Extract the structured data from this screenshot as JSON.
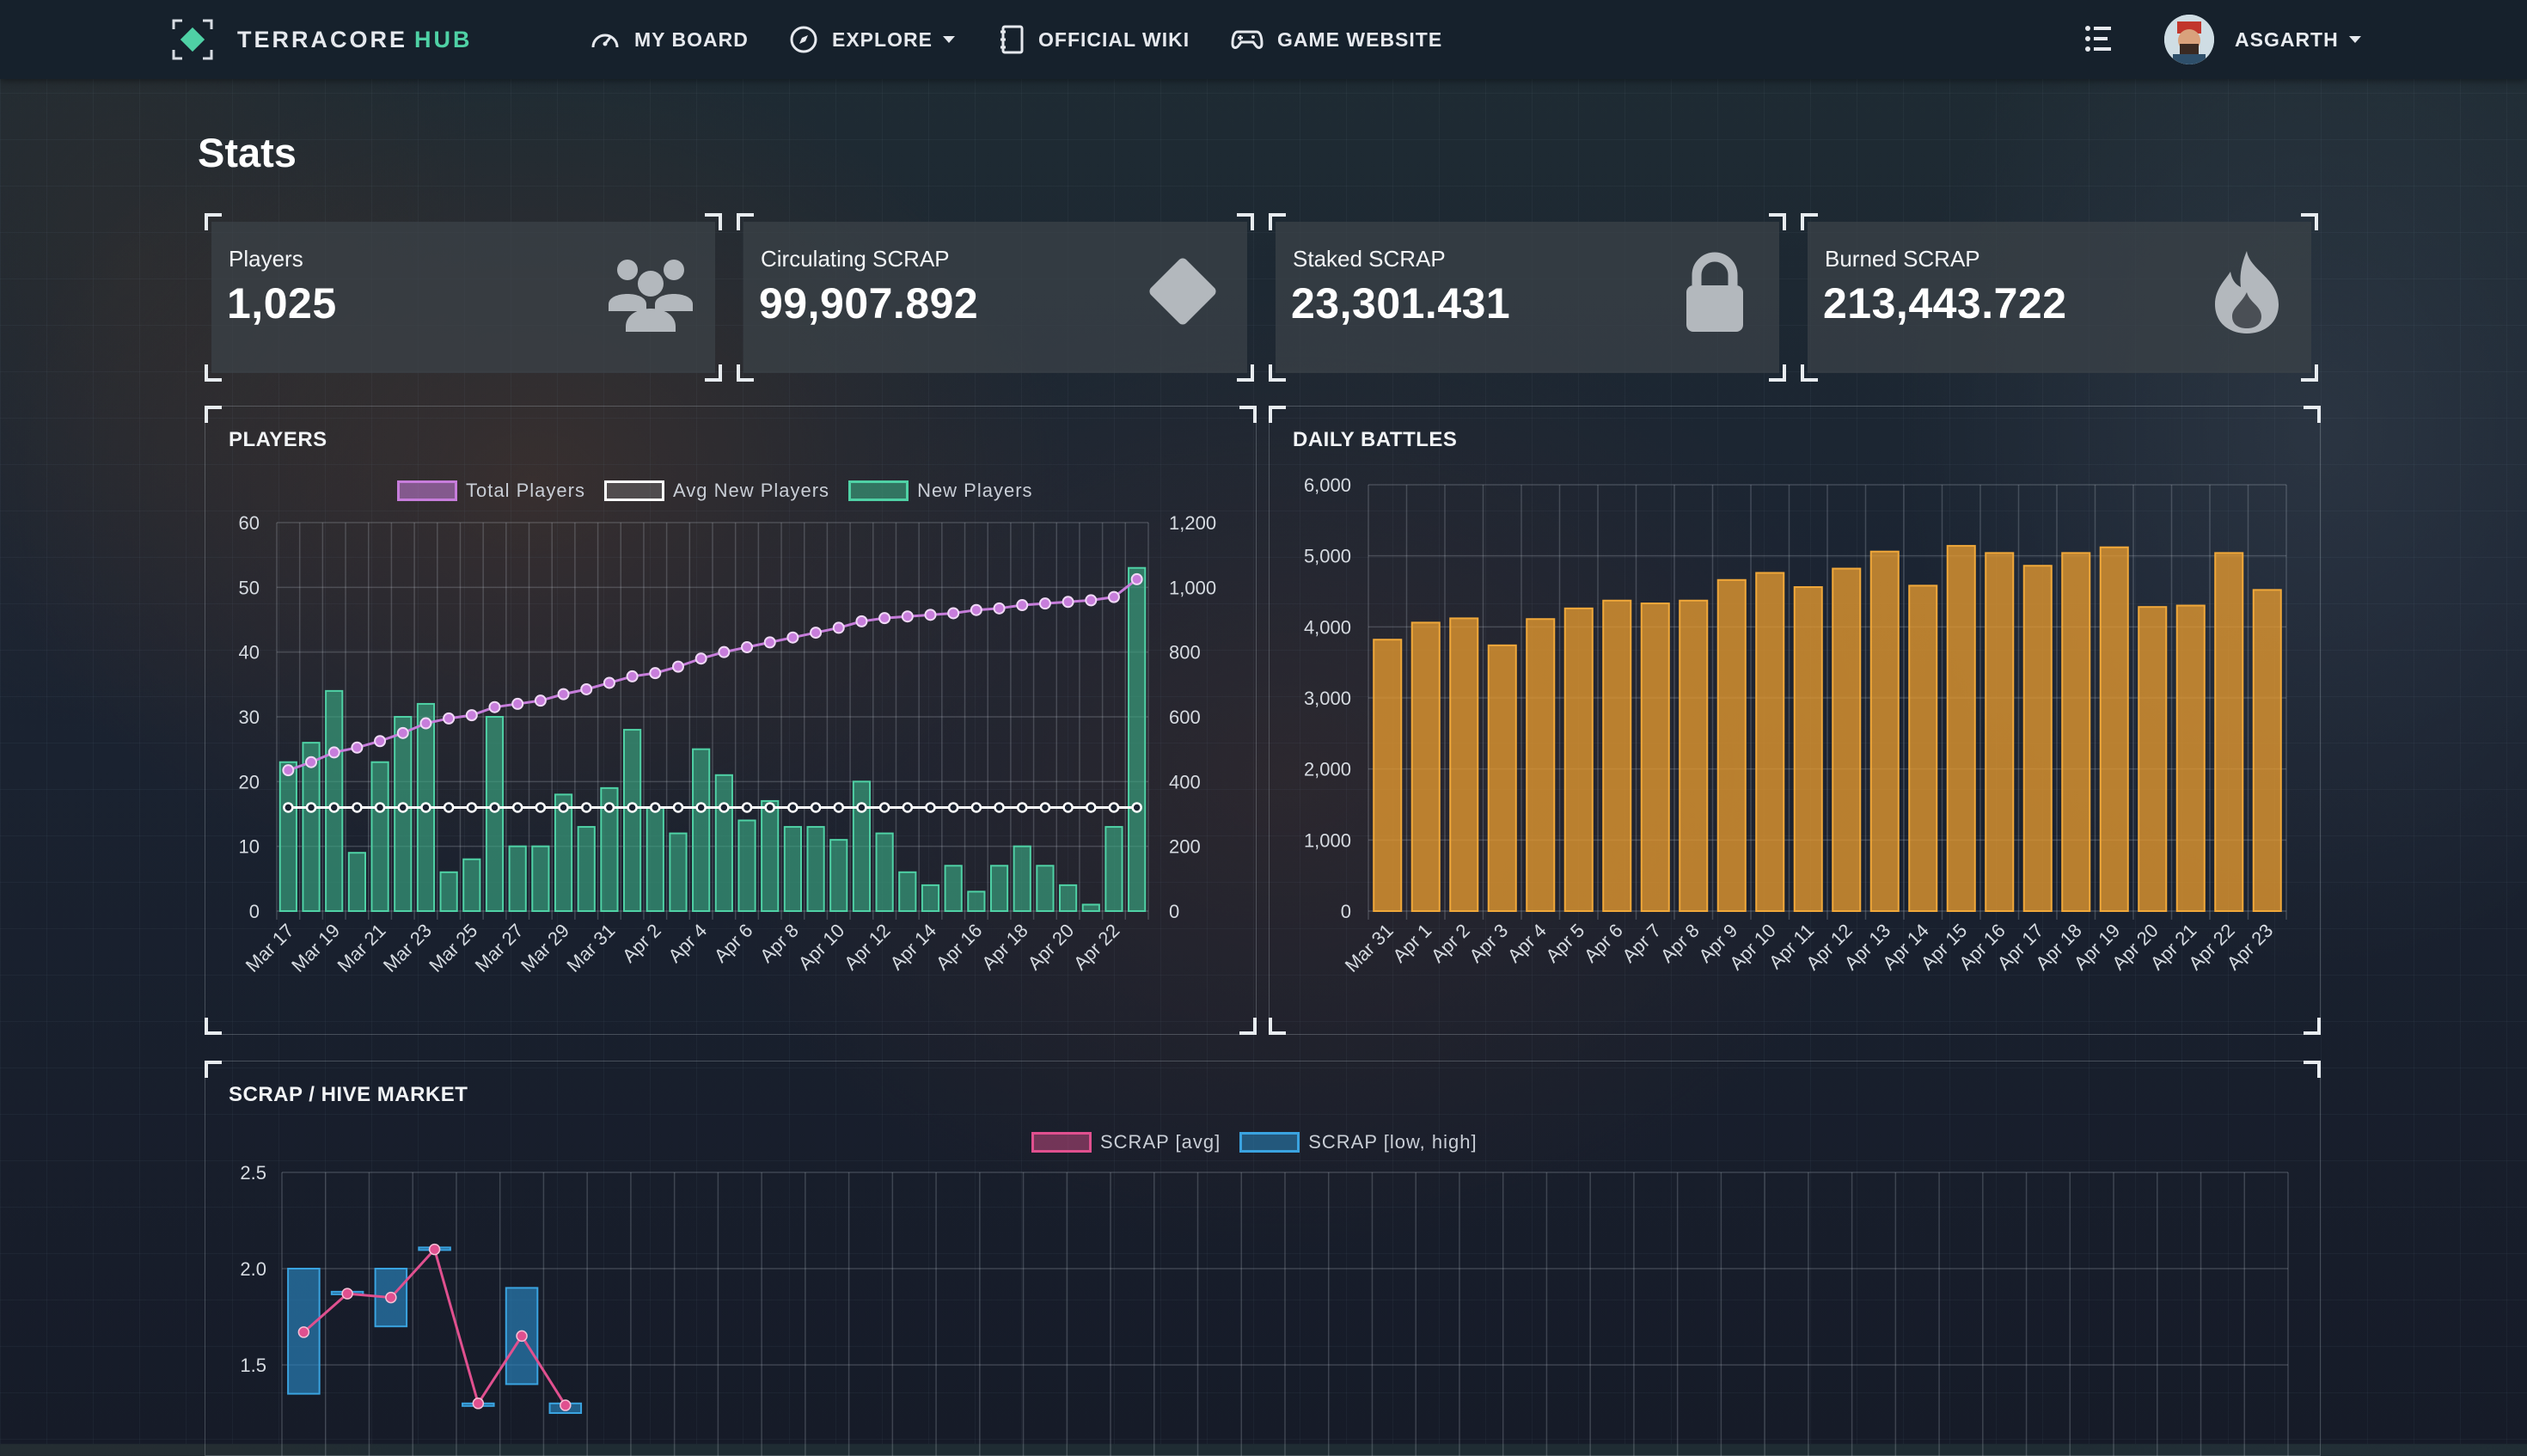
{
  "nav": {
    "logo_text": "TERRACORE",
    "logo_accent": "HUB",
    "items": [
      {
        "label": "MY BOARD",
        "icon": "gauge-icon"
      },
      {
        "label": "EXPLORE",
        "icon": "compass-icon",
        "dropdown": true
      },
      {
        "label": "OFFICIAL WIKI",
        "icon": "book-icon"
      },
      {
        "label": "GAME WEBSITE",
        "icon": "gamepad-icon"
      }
    ],
    "user": {
      "name": "ASGARTH"
    }
  },
  "page": {
    "title": "Stats"
  },
  "stats": [
    {
      "label": "Players",
      "value": "1,025",
      "icon": "users-icon"
    },
    {
      "label": "Circulating SCRAP",
      "value": "99,907.892",
      "icon": "diamond-icon"
    },
    {
      "label": "Staked SCRAP",
      "value": "23,301.431",
      "icon": "lock-icon"
    },
    {
      "label": "Burned SCRAP",
      "value": "213,443.722",
      "icon": "flame-icon"
    }
  ],
  "colors": {
    "accent": "#4fd1a5",
    "total_players": "#c77ddb",
    "avg_new_players": "#ffffff",
    "new_players": "#3aa882",
    "battles": "#e59a2f",
    "scrap_avg": "#e0508f",
    "scrap_range": "#2a86c0"
  },
  "panels": {
    "players_title": "PLAYERS",
    "battles_title": "DAILY BATTLES",
    "market_title": "SCRAP / HIVE MARKET"
  },
  "chart_data": [
    {
      "type": "bar",
      "title": "PLAYERS",
      "categories": [
        "Mar 17",
        "Mar 18",
        "Mar 19",
        "Mar 20",
        "Mar 21",
        "Mar 22",
        "Mar 23",
        "Mar 24",
        "Mar 25",
        "Mar 26",
        "Mar 27",
        "Mar 28",
        "Mar 29",
        "Mar 30",
        "Mar 31",
        "Apr 1",
        "Apr 2",
        "Apr 3",
        "Apr 4",
        "Apr 5",
        "Apr 6",
        "Apr 7",
        "Apr 8",
        "Apr 9",
        "Apr 10",
        "Apr 11",
        "Apr 12",
        "Apr 13",
        "Apr 14",
        "Apr 15",
        "Apr 16",
        "Apr 17",
        "Apr 18",
        "Apr 19",
        "Apr 20",
        "Apr 21",
        "Apr 22",
        "Apr 23"
      ],
      "tick_labels": [
        "Mar 17",
        "Mar 19",
        "Mar 21",
        "Mar 23",
        "Mar 25",
        "Mar 27",
        "Mar 29",
        "Mar 31",
        "Apr 2",
        "Apr 4",
        "Apr 6",
        "Apr 8",
        "Apr 10",
        "Apr 12",
        "Apr 14",
        "Apr 16",
        "Apr 18",
        "Apr 20",
        "Apr 22"
      ],
      "series": [
        {
          "name": "Total Players",
          "kind": "line",
          "axis": "right",
          "values": [
            435,
            460,
            490,
            505,
            525,
            550,
            580,
            595,
            605,
            630,
            640,
            650,
            670,
            685,
            705,
            725,
            735,
            755,
            780,
            800,
            815,
            830,
            845,
            860,
            875,
            895,
            905,
            910,
            915,
            920,
            930,
            935,
            945,
            950,
            955,
            960,
            970,
            1025
          ]
        },
        {
          "name": "Avg New Players",
          "kind": "line",
          "axis": "left",
          "values": [
            16,
            16,
            16,
            16,
            16,
            16,
            16,
            16,
            16,
            16,
            16,
            16,
            16,
            16,
            16,
            16,
            16,
            16,
            16,
            16,
            16,
            16,
            16,
            16,
            16,
            16,
            16,
            16,
            16,
            16,
            16,
            16,
            16,
            16,
            16,
            16,
            16,
            16
          ]
        },
        {
          "name": "New Players",
          "kind": "bar",
          "axis": "left",
          "values": [
            23,
            26,
            34,
            9,
            23,
            30,
            32,
            6,
            8,
            30,
            10,
            10,
            18,
            13,
            19,
            28,
            16,
            12,
            25,
            21,
            14,
            17,
            13,
            13,
            11,
            20,
            12,
            6,
            4,
            7,
            3,
            7,
            10,
            7,
            4,
            1,
            13,
            53
          ]
        }
      ],
      "ylim": [
        0,
        60
      ],
      "y_ticks": [
        0,
        10,
        20,
        30,
        40,
        50,
        60
      ],
      "y2lim": [
        0,
        1200
      ],
      "y2_ticks": [
        "0",
        "200",
        "400",
        "600",
        "800",
        "1,000",
        "1,200"
      ],
      "legend": "top",
      "grid": true
    },
    {
      "type": "bar",
      "title": "DAILY BATTLES",
      "categories": [
        "Mar 31",
        "Apr 1",
        "Apr 2",
        "Apr 3",
        "Apr 4",
        "Apr 5",
        "Apr 6",
        "Apr 7",
        "Apr 8",
        "Apr 9",
        "Apr 10",
        "Apr 11",
        "Apr 12",
        "Apr 13",
        "Apr 14",
        "Apr 15",
        "Apr 16",
        "Apr 17",
        "Apr 18",
        "Apr 19",
        "Apr 20",
        "Apr 21",
        "Apr 22",
        "Apr 23"
      ],
      "values": [
        3820,
        4060,
        4120,
        3740,
        4110,
        4260,
        4370,
        4330,
        4370,
        4660,
        4760,
        4560,
        4820,
        5060,
        4580,
        5140,
        5040,
        4860,
        5040,
        5120,
        4280,
        4300,
        5040,
        4520
      ],
      "ylim": [
        0,
        6000
      ],
      "y_ticks": [
        "0",
        "1,000",
        "2,000",
        "3,000",
        "4,000",
        "5,000",
        "6,000"
      ],
      "grid": true
    },
    {
      "type": "line",
      "title": "SCRAP / HIVE MARKET",
      "series": [
        {
          "name": "SCRAP [avg]",
          "kind": "line",
          "points": [
            [
              0,
              1.67
            ],
            [
              1,
              1.87
            ],
            [
              2,
              1.85
            ],
            [
              3,
              2.1
            ],
            [
              4,
              1.3
            ],
            [
              5,
              1.65
            ],
            [
              6,
              1.29
            ]
          ]
        },
        {
          "name": "SCRAP [low, high]",
          "kind": "range-bar",
          "ranges": [
            [
              0,
              1.35,
              2.0
            ],
            [
              1,
              1.87,
              1.88
            ],
            [
              2,
              1.7,
              2.0
            ],
            [
              3,
              2.1,
              2.11
            ],
            [
              4,
              1.29,
              1.3
            ],
            [
              5,
              1.4,
              1.9
            ],
            [
              6,
              1.25,
              1.3
            ]
          ]
        }
      ],
      "y_ticks": [
        "1.5",
        "2.0",
        "2.5"
      ],
      "ylim": [
        1.25,
        2.5
      ],
      "legend": "top",
      "grid": true
    }
  ]
}
